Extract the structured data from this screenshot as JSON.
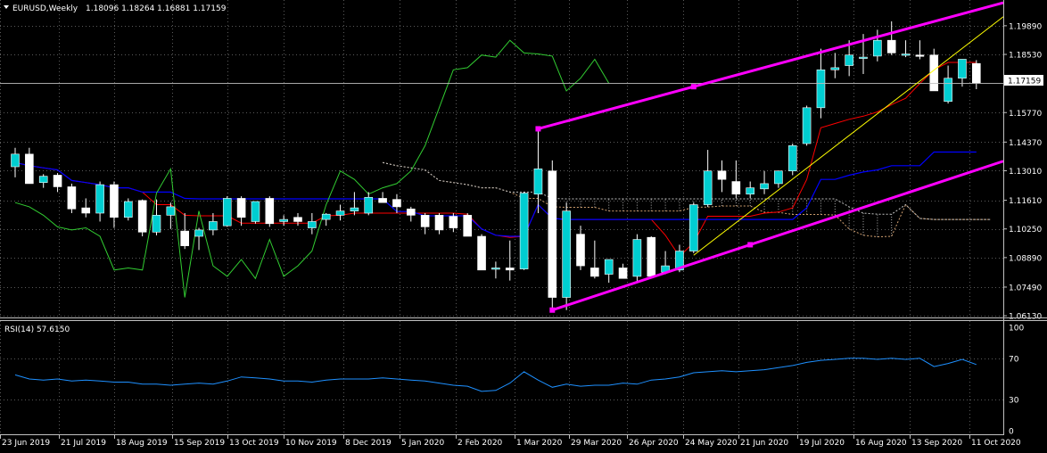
{
  "header": {
    "symbol_label": "EURUSD,Weekly",
    "ohlc_label": "1.18096 1.18264 1.16881 1.17159"
  },
  "rsi_panel": {
    "label": "RSI(14) 57.6150",
    "levels": [
      "100",
      "70",
      "30",
      "0"
    ]
  },
  "colors": {
    "background": "#000000",
    "grid": "#5a5a5a",
    "bull_candle": "#00ced1",
    "bear_candle": "#ffffff",
    "tenkan": "#ff0000",
    "kijun": "#0000ff",
    "chikou": "#32cd32",
    "kumo": "#a0a0a0",
    "channel": "#ff00ff",
    "trendline": "#ffff00",
    "rsi_line": "#1e90ff",
    "price_line": "#c0c0c0"
  },
  "chart_data": {
    "type": "candlestick",
    "symbol": "EURUSD",
    "timeframe": "Weekly",
    "last_price": "1.17159",
    "y_ticks": [
      "1.19890",
      "1.18530",
      "1.15770",
      "1.14370",
      "1.13010",
      "1.11610",
      "1.10250",
      "1.08890",
      "1.07490",
      "1.06130"
    ],
    "x_ticks": [
      "23 Jun 2019",
      "21 Jul 2019",
      "18 Aug 2019",
      "15 Sep 2019",
      "13 Oct 2019",
      "10 Nov 2019",
      "8 Dec 2019",
      "5 Jan 2020",
      "2 Feb 2020",
      "1 Mar 2020",
      "29 Mar 2020",
      "26 Apr 2020",
      "24 May 2020",
      "21 Jun 2020",
      "19 Jul 2020",
      "16 Aug 2020",
      "13 Sep 2020",
      "11 Oct 2020"
    ],
    "ylim": [
      1.0605,
      1.2035
    ],
    "candles": [
      {
        "o": 1.132,
        "h": 1.141,
        "l": 1.127,
        "c": 1.138
      },
      {
        "o": 1.138,
        "h": 1.141,
        "l": 1.124,
        "c": 1.124
      },
      {
        "o": 1.1245,
        "h": 1.1285,
        "l": 1.122,
        "c": 1.1275
      },
      {
        "o": 1.128,
        "h": 1.129,
        "l": 1.12,
        "c": 1.1225
      },
      {
        "o": 1.1225,
        "h": 1.124,
        "l": 1.11,
        "c": 1.112
      },
      {
        "o": 1.1125,
        "h": 1.117,
        "l": 1.108,
        "c": 1.11
      },
      {
        "o": 1.11,
        "h": 1.125,
        "l": 1.106,
        "c": 1.1235
      },
      {
        "o": 1.1235,
        "h": 1.125,
        "l": 1.103,
        "c": 1.108
      },
      {
        "o": 1.108,
        "h": 1.117,
        "l": 1.1065,
        "c": 1.1155
      },
      {
        "o": 1.116,
        "h": 1.1165,
        "l": 1.099,
        "c": 1.101
      },
      {
        "o": 1.101,
        "h": 1.1165,
        "l": 1.0995,
        "c": 1.109
      },
      {
        "o": 1.109,
        "h": 1.115,
        "l": 1.1025,
        "c": 1.113
      },
      {
        "o": 1.1015,
        "h": 1.11,
        "l": 1.093,
        "c": 1.0945
      },
      {
        "o": 1.099,
        "h": 1.103,
        "l": 1.0925,
        "c": 1.102
      },
      {
        "o": 1.102,
        "h": 1.11,
        "l": 1.0995,
        "c": 1.106
      },
      {
        "o": 1.104,
        "h": 1.118,
        "l": 1.1035,
        "c": 1.117
      },
      {
        "o": 1.117,
        "h": 1.118,
        "l": 1.104,
        "c": 1.108
      },
      {
        "o": 1.106,
        "h": 1.1155,
        "l": 1.105,
        "c": 1.1155
      },
      {
        "o": 1.117,
        "h": 1.118,
        "l": 1.1035,
        "c": 1.105
      },
      {
        "o": 1.106,
        "h": 1.109,
        "l": 1.104,
        "c": 1.107
      },
      {
        "o": 1.108,
        "h": 1.11,
        "l": 1.104,
        "c": 1.106
      },
      {
        "o": 1.103,
        "h": 1.11,
        "l": 1.1,
        "c": 1.106
      },
      {
        "o": 1.107,
        "h": 1.11,
        "l": 1.104,
        "c": 1.1095
      },
      {
        "o": 1.109,
        "h": 1.114,
        "l": 1.1065,
        "c": 1.111
      },
      {
        "o": 1.111,
        "h": 1.12,
        "l": 1.109,
        "c": 1.1125
      },
      {
        "o": 1.11,
        "h": 1.12,
        "l": 1.109,
        "c": 1.1175
      },
      {
        "o": 1.117,
        "h": 1.12,
        "l": 1.115,
        "c": 1.115
      },
      {
        "o": 1.1165,
        "h": 1.119,
        "l": 1.11,
        "c": 1.113
      },
      {
        "o": 1.112,
        "h": 1.113,
        "l": 1.106,
        "c": 1.109
      },
      {
        "o": 1.109,
        "h": 1.11,
        "l": 1.1,
        "c": 1.1035
      },
      {
        "o": 1.109,
        "h": 1.11,
        "l": 1.1,
        "c": 1.102
      },
      {
        "o": 1.1085,
        "h": 1.11,
        "l": 1.101,
        "c": 1.103
      },
      {
        "o": 1.109,
        "h": 1.11,
        "l": 1.099,
        "c": 1.099
      },
      {
        "o": 1.099,
        "h": 1.1,
        "l": 1.085,
        "c": 1.083
      },
      {
        "o": 1.0835,
        "h": 1.087,
        "l": 1.079,
        "c": 1.084
      },
      {
        "o": 1.084,
        "h": 1.097,
        "l": 1.078,
        "c": 1.083
      },
      {
        "o": 1.0835,
        "h": 1.12,
        "l": 1.083,
        "c": 1.1195
      },
      {
        "o": 1.119,
        "h": 1.15,
        "l": 1.11,
        "c": 1.131
      },
      {
        "o": 1.13,
        "h": 1.135,
        "l": 1.065,
        "c": 1.07
      },
      {
        "o": 1.07,
        "h": 1.115,
        "l": 1.064,
        "c": 1.111
      },
      {
        "o": 1.1,
        "h": 1.104,
        "l": 1.083,
        "c": 1.085
      },
      {
        "o": 1.084,
        "h": 1.097,
        "l": 1.079,
        "c": 1.08
      },
      {
        "o": 1.081,
        "h": 1.088,
        "l": 1.077,
        "c": 1.088
      },
      {
        "o": 1.084,
        "h": 1.086,
        "l": 1.079,
        "c": 1.079
      },
      {
        "o": 1.08,
        "h": 1.1,
        "l": 1.077,
        "c": 1.0975
      },
      {
        "o": 1.0985,
        "h": 1.099,
        "l": 1.08,
        "c": 1.08
      },
      {
        "o": 1.082,
        "h": 1.092,
        "l": 1.081,
        "c": 1.085
      },
      {
        "o": 1.083,
        "h": 1.095,
        "l": 1.082,
        "c": 1.092
      },
      {
        "o": 1.092,
        "h": 1.115,
        "l": 1.091,
        "c": 1.114
      },
      {
        "o": 1.114,
        "h": 1.14,
        "l": 1.113,
        "c": 1.13
      },
      {
        "o": 1.13,
        "h": 1.135,
        "l": 1.12,
        "c": 1.126
      },
      {
        "o": 1.125,
        "h": 1.135,
        "l": 1.117,
        "c": 1.119
      },
      {
        "o": 1.119,
        "h": 1.125,
        "l": 1.117,
        "c": 1.122
      },
      {
        "o": 1.1215,
        "h": 1.13,
        "l": 1.119,
        "c": 1.124
      },
      {
        "o": 1.124,
        "h": 1.13,
        "l": 1.122,
        "c": 1.13
      },
      {
        "o": 1.13,
        "h": 1.143,
        "l": 1.128,
        "c": 1.142
      },
      {
        "o": 1.143,
        "h": 1.161,
        "l": 1.142,
        "c": 1.16
      },
      {
        "o": 1.16,
        "h": 1.188,
        "l": 1.155,
        "c": 1.178
      },
      {
        "o": 1.178,
        "h": 1.186,
        "l": 1.174,
        "c": 1.179
      },
      {
        "o": 1.18,
        "h": 1.192,
        "l": 1.175,
        "c": 1.185
      },
      {
        "o": 1.184,
        "h": 1.195,
        "l": 1.176,
        "c": 1.184
      },
      {
        "o": 1.1845,
        "h": 1.197,
        "l": 1.182,
        "c": 1.192
      },
      {
        "o": 1.192,
        "h": 1.201,
        "l": 1.185,
        "c": 1.186
      },
      {
        "o": 1.1855,
        "h": 1.192,
        "l": 1.184,
        "c": 1.1855
      },
      {
        "o": 1.185,
        "h": 1.192,
        "l": 1.183,
        "c": 1.1845
      },
      {
        "o": 1.185,
        "h": 1.188,
        "l": 1.173,
        "c": 1.168
      },
      {
        "o": 1.163,
        "h": 1.18,
        "l": 1.162,
        "c": 1.174
      },
      {
        "o": 1.174,
        "h": 1.183,
        "l": 1.17,
        "c": 1.183
      },
      {
        "o": 1.181,
        "h": 1.1826,
        "l": 1.1688,
        "c": 1.1716
      }
    ],
    "rsi": [
      54,
      50,
      49,
      50,
      48,
      49,
      48,
      47,
      47,
      45,
      45,
      44,
      45,
      46,
      45,
      48,
      52,
      51,
      50,
      48,
      48,
      47,
      49,
      50,
      50,
      50,
      51,
      50,
      49,
      48,
      46,
      44,
      43,
      38,
      39,
      46,
      57,
      49,
      42,
      45,
      43,
      44,
      44,
      46,
      45,
      49,
      50,
      52,
      56,
      57,
      58,
      57,
      58,
      59,
      61,
      63,
      66,
      68,
      69,
      70,
      70,
      69,
      70,
      69,
      70,
      62,
      65,
      69,
      64
    ]
  }
}
